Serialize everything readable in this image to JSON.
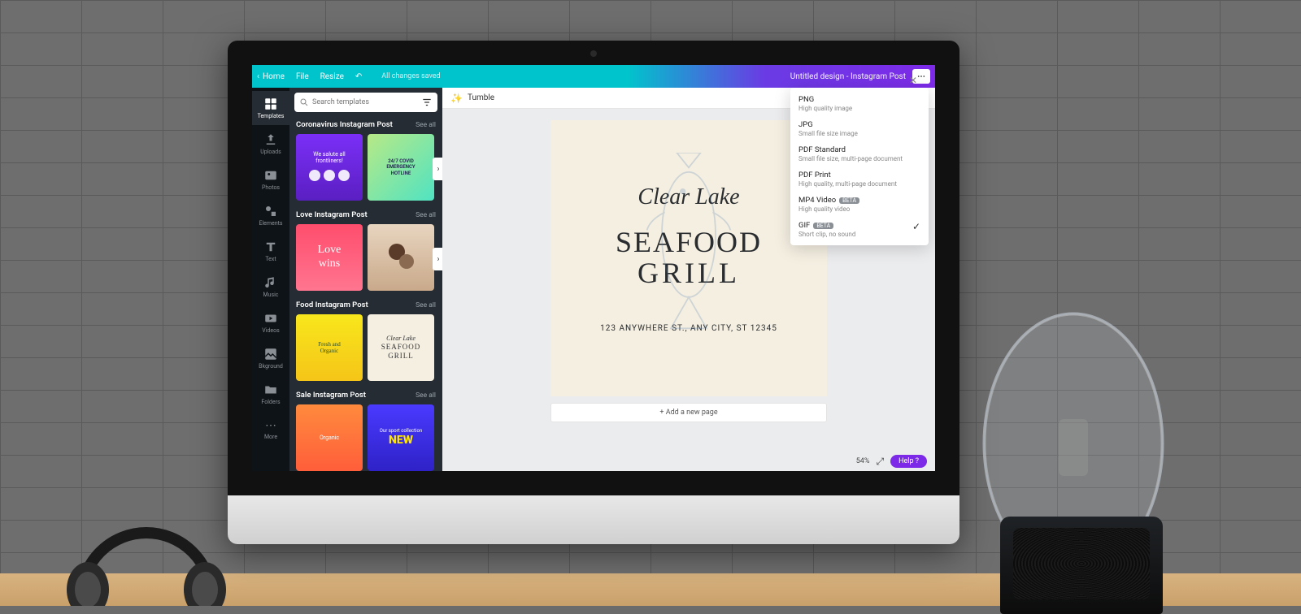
{
  "topbar": {
    "home": "Home",
    "file": "File",
    "resize": "Resize",
    "save_status": "All changes saved",
    "doc_title": "Untitled design - Instagram Post"
  },
  "rail": [
    {
      "label": "Templates",
      "active": true
    },
    {
      "label": "Uploads"
    },
    {
      "label": "Photos"
    },
    {
      "label": "Elements"
    },
    {
      "label": "Text"
    },
    {
      "label": "Music"
    },
    {
      "label": "Videos"
    },
    {
      "label": "Bkground"
    },
    {
      "label": "Folders"
    },
    {
      "label": "More"
    }
  ],
  "search": {
    "placeholder": "Search templates"
  },
  "categories": [
    {
      "title": "Coronavirus Instagram Post",
      "see": "See all",
      "thumbs": [
        {
          "line1": "We salute all",
          "line2": "frontliners!"
        },
        {
          "line1": "24/7 COVID",
          "line2": "EMERGENCY",
          "line3": "HOTLINE"
        }
      ]
    },
    {
      "title": "Love Instagram Post",
      "see": "See all",
      "thumbs": [
        {
          "line1": "Love",
          "line2": "wins"
        },
        {
          "line1": ""
        }
      ]
    },
    {
      "title": "Food Instagram Post",
      "see": "See all",
      "thumbs": [
        {
          "line1": "Fresh and",
          "line2": "Organic"
        },
        {
          "line1": "Clear Lake",
          "line2": "SEAFOOD",
          "line3": "GRILL"
        }
      ]
    },
    {
      "title": "Sale Instagram Post",
      "see": "See all",
      "thumbs": [
        {
          "line1": "Organic"
        },
        {
          "line1": "Our sport collection",
          "line2": "NEW"
        }
      ]
    }
  ],
  "page_tab": {
    "label": "Tumble"
  },
  "design": {
    "script": "Clear Lake",
    "line1": "SEAFOOD",
    "line2": "GRILL",
    "address": "123 ANYWHERE ST., ANY CITY, ST 12345"
  },
  "add_page": "+ Add a new page",
  "footer": {
    "zoom": "54%",
    "help": "Help ?"
  },
  "export": [
    {
      "title": "PNG",
      "sub": "High quality image"
    },
    {
      "title": "JPG",
      "sub": "Small file size image"
    },
    {
      "title": "PDF Standard",
      "sub": "Small file size, multi-page document"
    },
    {
      "title": "PDF Print",
      "sub": "High quality, multi-page document"
    },
    {
      "title": "MP4 Video",
      "sub": "High quality video",
      "badge": "BETA"
    },
    {
      "title": "GIF",
      "sub": "Short clip, no sound",
      "badge": "BETA",
      "checked": true
    }
  ]
}
